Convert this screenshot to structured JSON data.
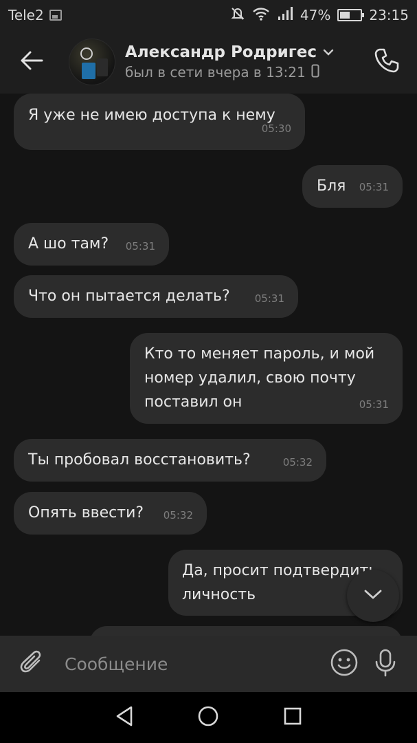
{
  "status_bar": {
    "carrier": "Tele2",
    "battery": "47%",
    "battery_level": 0.47,
    "time": "23:15",
    "icons": [
      "image-icon",
      "mute-icon",
      "wifi-icon",
      "signal-icon",
      "battery-icon"
    ]
  },
  "header": {
    "contact_name": "Александр Родригес",
    "status": "был в сети вчера в 13:21",
    "icons": [
      "back-arrow-icon",
      "chevron-down-icon",
      "mobile-device-icon",
      "phone-icon"
    ]
  },
  "messages": [
    {
      "direction": "in",
      "lines": [
        "Я уже не имею доступа к нему"
      ],
      "time": "05:30"
    },
    {
      "direction": "out",
      "lines": [
        "Бля"
      ],
      "time": "05:31"
    },
    {
      "direction": "in",
      "lines": [
        "А шо там?"
      ],
      "time": "05:31"
    },
    {
      "direction": "in",
      "lines": [
        "Что он пытается делать?"
      ],
      "time": "05:31"
    },
    {
      "direction": "out",
      "lines": [
        "Кто то меняет пароль, и мой",
        "номер удалил, свою почту",
        "поставил он"
      ],
      "time": "05:31"
    },
    {
      "direction": "in",
      "lines": [
        "Ты пробовал восстановить?"
      ],
      "time": "05:32"
    },
    {
      "direction": "in",
      "lines": [
        "Опять ввести?"
      ],
      "time": "05:32"
    },
    {
      "direction": "out",
      "lines": [
        "Да, просит подтвердить",
        "личность"
      ],
      "time": ""
    }
  ],
  "composer": {
    "placeholder": "Сообщение",
    "icons": [
      "paperclip-icon",
      "emoji-icon",
      "microphone-icon"
    ]
  },
  "nav_bar": {
    "icons": [
      "back-triangle-icon",
      "home-circle-icon",
      "recents-square-icon"
    ]
  },
  "colors": {
    "chat_background": "#141414",
    "bar_background": "#1e1e1e",
    "bubble": "#2c2c2c",
    "text": "#e6e6e6",
    "muted": "#9a9a9a"
  }
}
